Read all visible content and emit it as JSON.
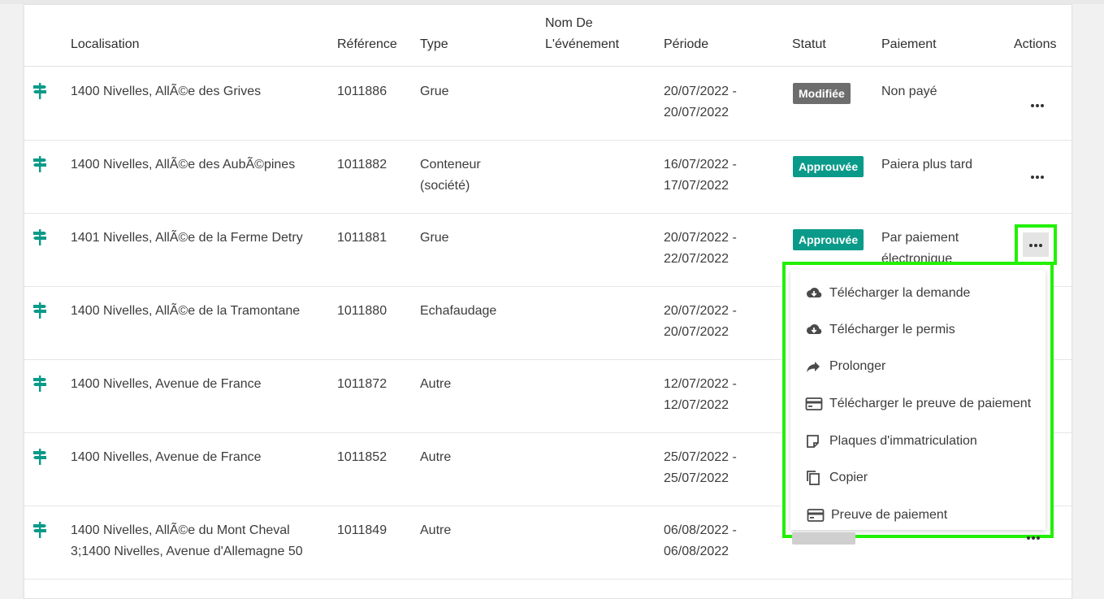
{
  "table": {
    "headers": {
      "localisation": "Localisation",
      "reference": "Référence",
      "type": "Type",
      "nom_line1": "Nom De",
      "nom_line2": "L'événement",
      "periode": "Période",
      "statut": "Statut",
      "paiement": "Paiement",
      "actions": "Actions"
    },
    "rows": [
      {
        "loc1": "1400 Nivelles, AllÃ©e des Grives",
        "loc2": "",
        "ref": "1011886",
        "type1": "Grue",
        "type2": "",
        "p1": "20/07/2022 -",
        "p2": "20/07/2022",
        "status": "Modifiée",
        "status_kind": "mod",
        "pay1": "Non payé",
        "pay2": ""
      },
      {
        "loc1": "1400 Nivelles, AllÃ©e des AubÃ©pines",
        "loc2": "",
        "ref": "1011882",
        "type1": "Conteneur",
        "type2": "(société)",
        "p1": "16/07/2022 -",
        "p2": "17/07/2022",
        "status": "Approuvée",
        "status_kind": "app",
        "pay1": "Paiera plus tard",
        "pay2": ""
      },
      {
        "loc1": "1401 Nivelles, AllÃ©e de la Ferme Detry",
        "loc2": "",
        "ref": "1011881",
        "type1": "Grue",
        "type2": "",
        "p1": "20/07/2022 -",
        "p2": "22/07/2022",
        "status": "Approuvée",
        "status_kind": "app",
        "pay1": "Par paiement",
        "pay2": "électronique"
      },
      {
        "loc1": "1400 Nivelles, AllÃ©e de la Tramontane",
        "loc2": "",
        "ref": "1011880",
        "type1": "Echafaudage",
        "type2": "",
        "p1": "20/07/2022 -",
        "p2": "20/07/2022",
        "status": "",
        "status_kind": "",
        "pay1": "",
        "pay2": ""
      },
      {
        "loc1": "1400 Nivelles, Avenue de France",
        "loc2": "",
        "ref": "1011872",
        "type1": "Autre",
        "type2": "",
        "p1": "12/07/2022 -",
        "p2": "12/07/2022",
        "status": "",
        "status_kind": "",
        "pay1": "",
        "pay2": ""
      },
      {
        "loc1": "1400 Nivelles, Avenue de France",
        "loc2": "",
        "ref": "1011852",
        "type1": "Autre",
        "type2": "",
        "p1": "25/07/2022 -",
        "p2": "25/07/2022",
        "status": "",
        "status_kind": "",
        "pay1": "",
        "pay2": ""
      },
      {
        "loc1": "1400 Nivelles, AllÃ©e du Mont Cheval",
        "loc2": "3;1400 Nivelles, Avenue d'Allemagne 50",
        "ref": "1011849",
        "type1": "Autre",
        "type2": "",
        "p1": "06/08/2022 -",
        "p2": "06/08/2022",
        "status": "",
        "status_kind": "",
        "pay1": "",
        "pay2": ""
      }
    ]
  },
  "menu": {
    "items": [
      {
        "label": "Télécharger la demande",
        "icon": "cloud-download-icon"
      },
      {
        "label": "Télécharger le permis",
        "icon": "cloud-download-icon"
      },
      {
        "label": "Prolonger",
        "icon": "share-arrow-icon"
      },
      {
        "label": "Télécharger le preuve de paiement",
        "icon": "credit-card-icon"
      },
      {
        "label": "Plaques d'immatriculation",
        "icon": "note-icon"
      },
      {
        "label": "Copier",
        "icon": "copy-icon"
      },
      {
        "label": "Preuve de paiement",
        "icon": "credit-card-icon"
      }
    ]
  },
  "colors": {
    "accent_teal": "#0a9a89",
    "badge_modified": "#6d6d6d",
    "highlight": "#22f000"
  }
}
